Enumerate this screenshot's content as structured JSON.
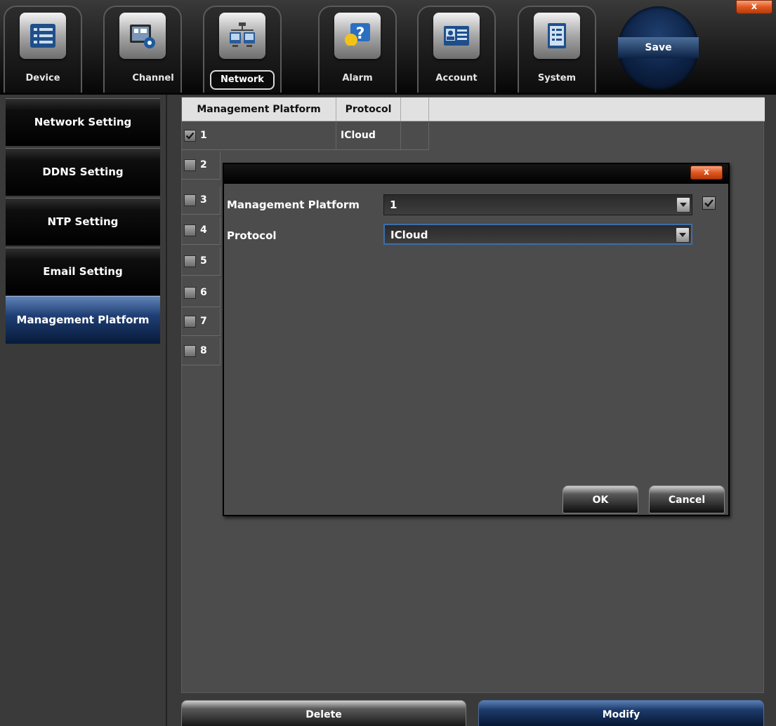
{
  "toolbar": {
    "tabs": [
      {
        "label": "Device",
        "icon": "device-list-icon"
      },
      {
        "label": "Channel",
        "icon": "channel-camera-icon"
      },
      {
        "label": "Network",
        "icon": "network-computers-icon",
        "active": true
      },
      {
        "label": "Alarm",
        "icon": "alarm-help-icon"
      },
      {
        "label": "Account",
        "icon": "account-card-icon"
      },
      {
        "label": "System",
        "icon": "system-document-icon"
      }
    ],
    "save_label": "Save",
    "close_label": "x"
  },
  "sidebar": {
    "items": [
      {
        "label": "Network Setting"
      },
      {
        "label": "DDNS Setting"
      },
      {
        "label": "NTP Setting"
      },
      {
        "label": "Email Setting"
      },
      {
        "label": "Management Platform",
        "active": true
      }
    ]
  },
  "table": {
    "columns": [
      "Management Platform",
      "Protocol",
      ""
    ],
    "rows": [
      {
        "num": "1",
        "protocol": "ICloud",
        "checked": true
      },
      {
        "num": "2",
        "protocol": "",
        "checked": false
      },
      {
        "num": "3",
        "protocol": "",
        "checked": false
      },
      {
        "num": "4",
        "protocol": "",
        "checked": false
      },
      {
        "num": "5",
        "protocol": "",
        "checked": false
      },
      {
        "num": "6",
        "protocol": "",
        "checked": false
      },
      {
        "num": "7",
        "protocol": "",
        "checked": false
      },
      {
        "num": "8",
        "protocol": "",
        "checked": false
      }
    ]
  },
  "actions": {
    "delete_label": "Delete",
    "modify_label": "Modify"
  },
  "dialog": {
    "close_label": "x",
    "platform_label": "Management Platform",
    "platform_value": "1",
    "platform_enabled": true,
    "protocol_label": "Protocol",
    "protocol_value": "ICloud",
    "ok_label": "OK",
    "cancel_label": "Cancel"
  },
  "colors": {
    "accent_blue": "#1f3f74",
    "close_orange": "#e0581e",
    "header_gray": "#e1e1e1",
    "panel_gray": "#4c4c4c"
  }
}
